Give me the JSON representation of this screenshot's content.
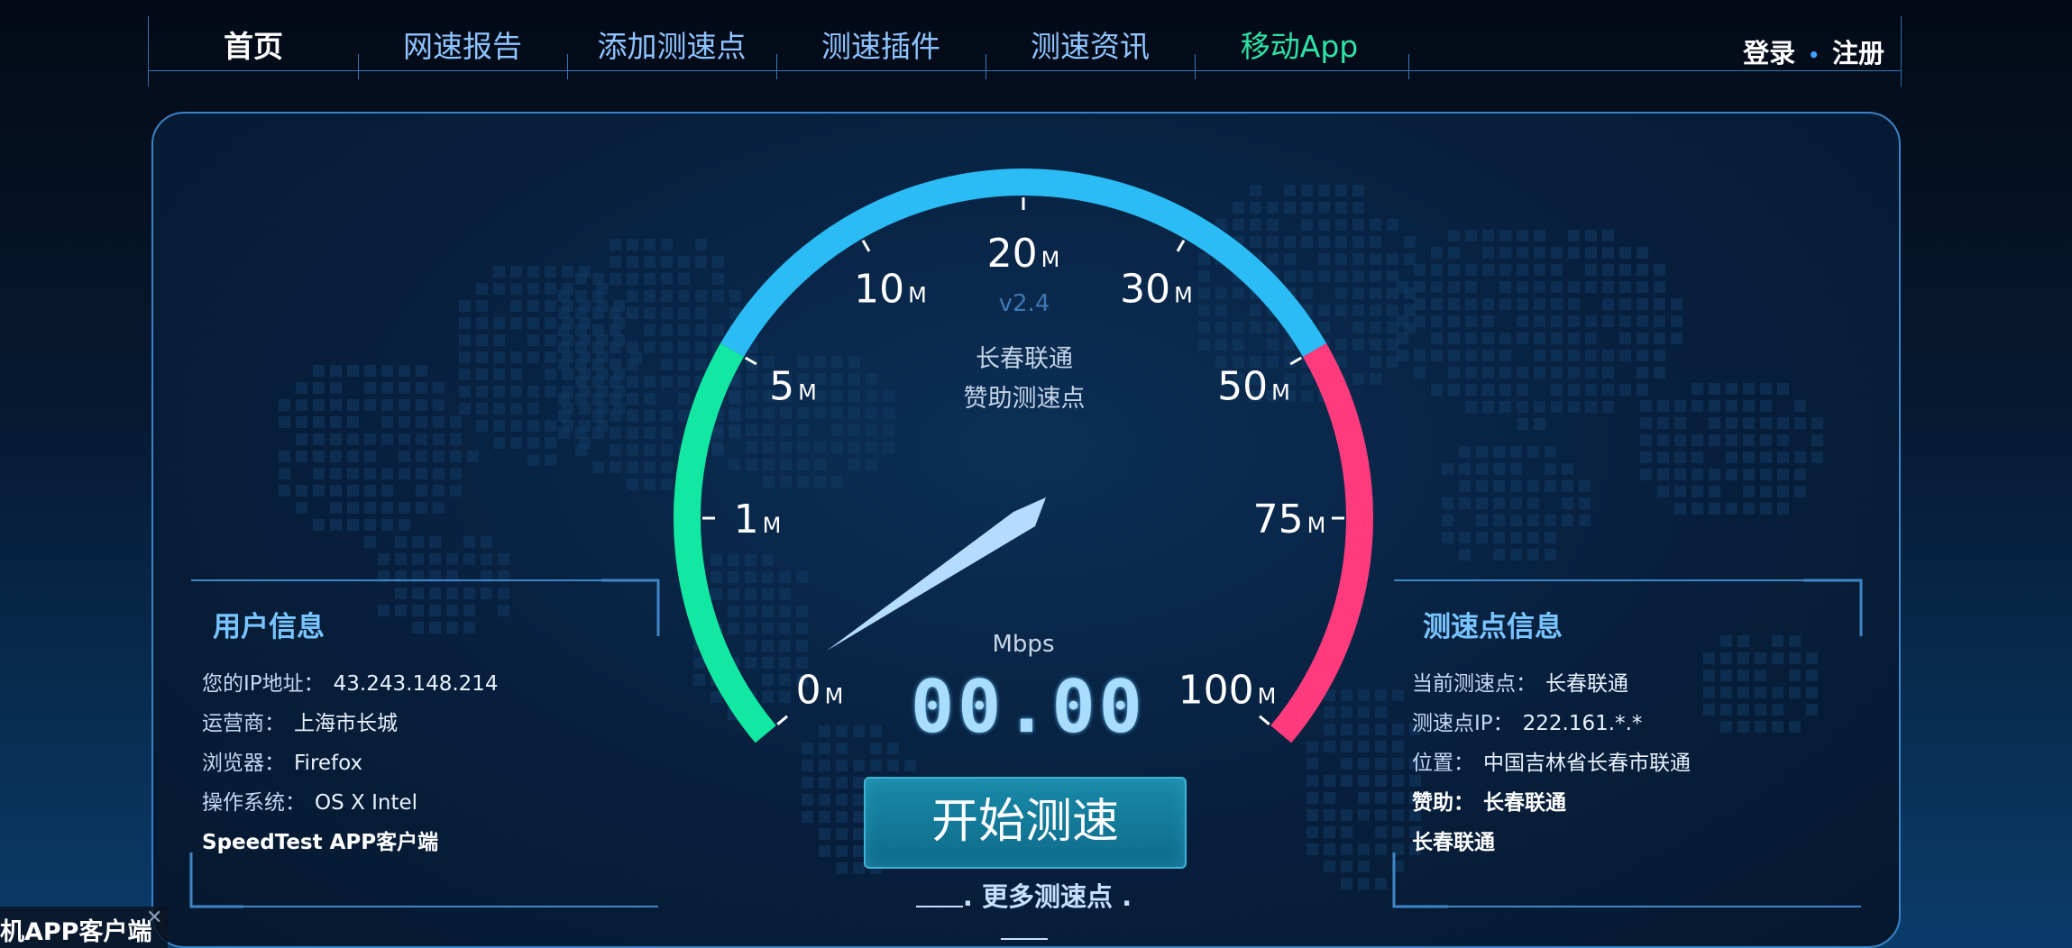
{
  "nav": {
    "items": [
      {
        "label": "首页"
      },
      {
        "label": "网速报告"
      },
      {
        "label": "添加测速点"
      },
      {
        "label": "测速插件"
      },
      {
        "label": "测速资讯"
      },
      {
        "label": "移动App"
      }
    ],
    "login_label": "登录",
    "separator": "•",
    "register_label": "注册"
  },
  "gauge": {
    "version": "v2.4",
    "server_name": "长春联通",
    "sponsor_text": "赞助测速点",
    "ticks": [
      "0",
      "1",
      "5",
      "10",
      "20",
      "30",
      "50",
      "75",
      "100"
    ],
    "unit_suffix": "M",
    "speed_unit": "Mbps",
    "speed_value": "00.00",
    "colors": {
      "low": "#13e8a3",
      "mid": "#2bbcf5",
      "high": "#ff3b7d"
    }
  },
  "user_info": {
    "title": "用户信息",
    "ip_label": "您的IP地址：",
    "ip_value": "43.243.148.214",
    "isp_label": "运营商：",
    "isp_value": "上海市长城",
    "browser_label": "浏览器：",
    "browser_value": "Firefox",
    "os_label": "操作系统：",
    "os_value": "OS X Intel",
    "app_link": "SpeedTest APP客户端"
  },
  "server_info": {
    "title": "测速点信息",
    "current_label": "当前测速点：",
    "current_value": "长春联通",
    "ip_label": "测速点IP：",
    "ip_value": "222.161.*.*",
    "location_label": "位置：",
    "location_value": "中国吉林省长春市联通",
    "sponsor_label": "赞助：",
    "sponsor_value": "长春联通",
    "sponsor_link": "长春联通"
  },
  "actions": {
    "start_label": "开始测速",
    "more_label": ". 更多测速点 ."
  },
  "floating_ad": {
    "text": "机APP客户端",
    "close": "✕"
  }
}
